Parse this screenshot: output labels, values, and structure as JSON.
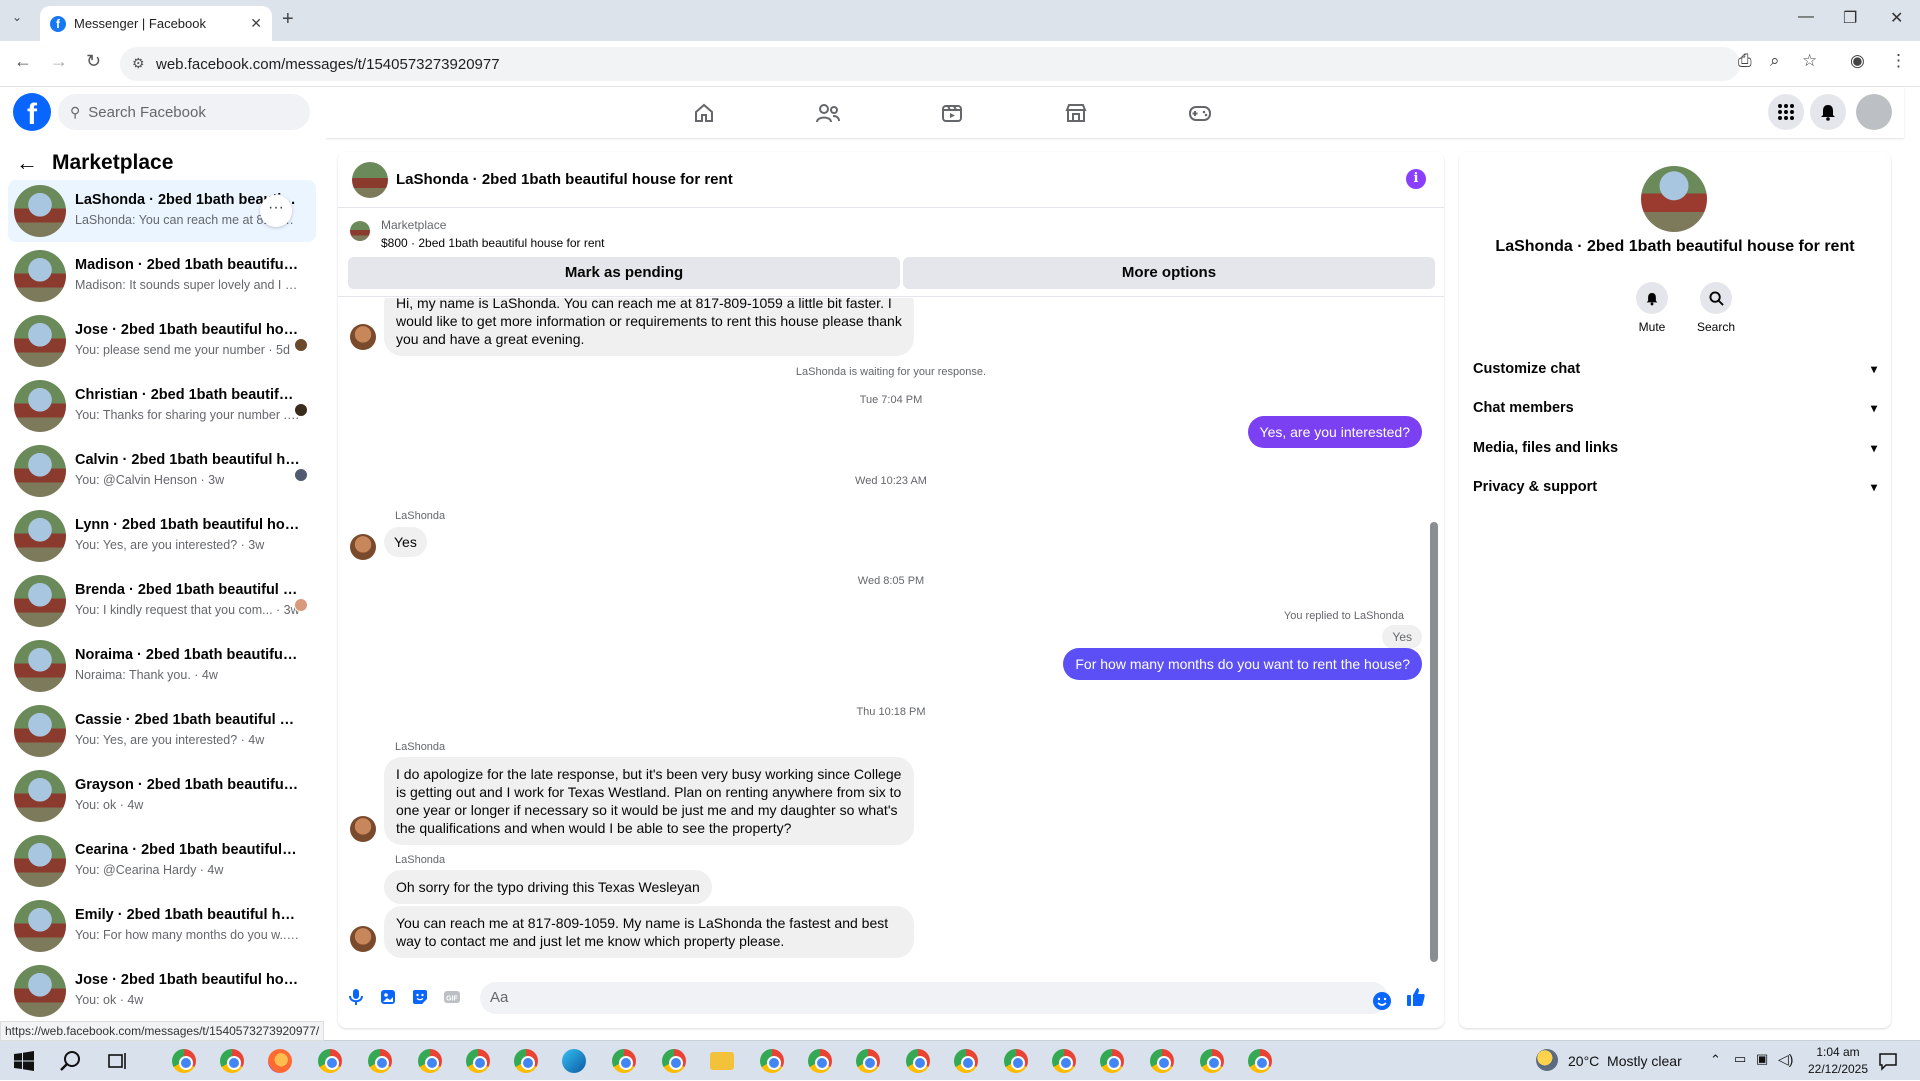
{
  "browser": {
    "tab_title": "Messenger | Facebook",
    "url": "web.facebook.com/messages/t/1540573273920977",
    "status_url": "https://web.facebook.com/messages/t/1540573273920977/"
  },
  "fb": {
    "search_placeholder": "Search Facebook"
  },
  "left": {
    "title": "Marketplace",
    "conversations": [
      {
        "title": "LaShonda · 2bed 1bath beautiful house for rent",
        "snippet": "LaShonda: You can reach me at 817-809-1059 · 1d",
        "active": true
      },
      {
        "title": "Madison · 2bed 1bath beautiful ho...",
        "snippet": "Madison: It sounds super lovely and I ... · 4d"
      },
      {
        "title": "Jose · 2bed 1bath beautiful hous...",
        "snippet": "You: please send me your number · 5d"
      },
      {
        "title": "Christian · 2bed 1bath beautiful ho...",
        "snippet": "You: Thanks for sharing your number ... · 1w"
      },
      {
        "title": "Calvin · 2bed 1bath beautiful ho...",
        "snippet": "You: @Calvin Henson · 3w"
      },
      {
        "title": "Lynn · 2bed 1bath beautiful house ...",
        "snippet": "You: Yes, are you interested? · 3w"
      },
      {
        "title": "Brenda · 2bed 1bath beautiful h...",
        "snippet": "You: I kindly request that you com... · 3w"
      },
      {
        "title": "Noraima · 2bed 1bath beautiful ho...",
        "snippet": "Noraima: Thank you. · 4w"
      },
      {
        "title": "Cassie · 2bed 1bath beautiful hous...",
        "snippet": "You: Yes, are you interested? · 4w"
      },
      {
        "title": "Grayson · 2bed 1bath beautiful ho...",
        "snippet": "You: ok · 4w"
      },
      {
        "title": "Cearina · 2bed 1bath beautiful hou...",
        "snippet": "You: @Cearina Hardy · 4w"
      },
      {
        "title": "Emily · 2bed 1bath beautiful house...",
        "snippet": "You: For how many months do you w... · 4w"
      },
      {
        "title": "Jose · 2bed 1bath beautiful house f...",
        "snippet": "You: ok · 4w"
      }
    ]
  },
  "chat": {
    "title": "LaShonda · 2bed 1bath beautiful house for rent",
    "marketplace_label": "Marketplace",
    "listing": "$800 · 2bed 1bath beautiful house for rent",
    "mark_pending": "Mark as pending",
    "more_options": "More options",
    "msg1": "Hi, my name is LaShonda. You can reach me at 817-809-1059 a little bit faster. I would like to get more information or requirements to rent this house please thank you and have a great evening.",
    "waiting": "LaShonda is waiting for your response.",
    "ts1": "Tue 7:04 PM",
    "my1": "Yes, are you interested?",
    "ts2": "Wed 10:23 AM",
    "sender": "LaShonda",
    "msg2": "Yes",
    "ts3": "Wed 8:05 PM",
    "replied": "You replied to LaShonda",
    "quoted": "Yes",
    "my2": "For how many months do you want to rent the house?",
    "ts4": "Thu 10:18 PM",
    "msg3": "I do apologize for the late response, but it's been very busy working since College is getting out and I work for Texas Westland. Plan on renting anywhere from six to one year or longer if necessary so it would be just me and my daughter so what's the qualifications and when would I be able to see the property?",
    "msg4": "Oh sorry for the typo driving this Texas Wesleyan",
    "msg5": "You can reach me at 817-809-1059. My name is LaShonda the fastest and best way to contact me and just let me know which property please.",
    "composer_placeholder": "Aa"
  },
  "right": {
    "name": "LaShonda · 2bed 1bath beautiful house for rent",
    "mute": "Mute",
    "search": "Search",
    "sections": [
      "Customize chat",
      "Chat members",
      "Media, files and links",
      "Privacy & support"
    ]
  },
  "taskbar": {
    "weather": "20°C  Mostly clear",
    "time": "1:04 am",
    "date": "22/12/2025"
  },
  "colors": {
    "accent": "#7b40f2",
    "fb_blue": "#0866ff"
  }
}
